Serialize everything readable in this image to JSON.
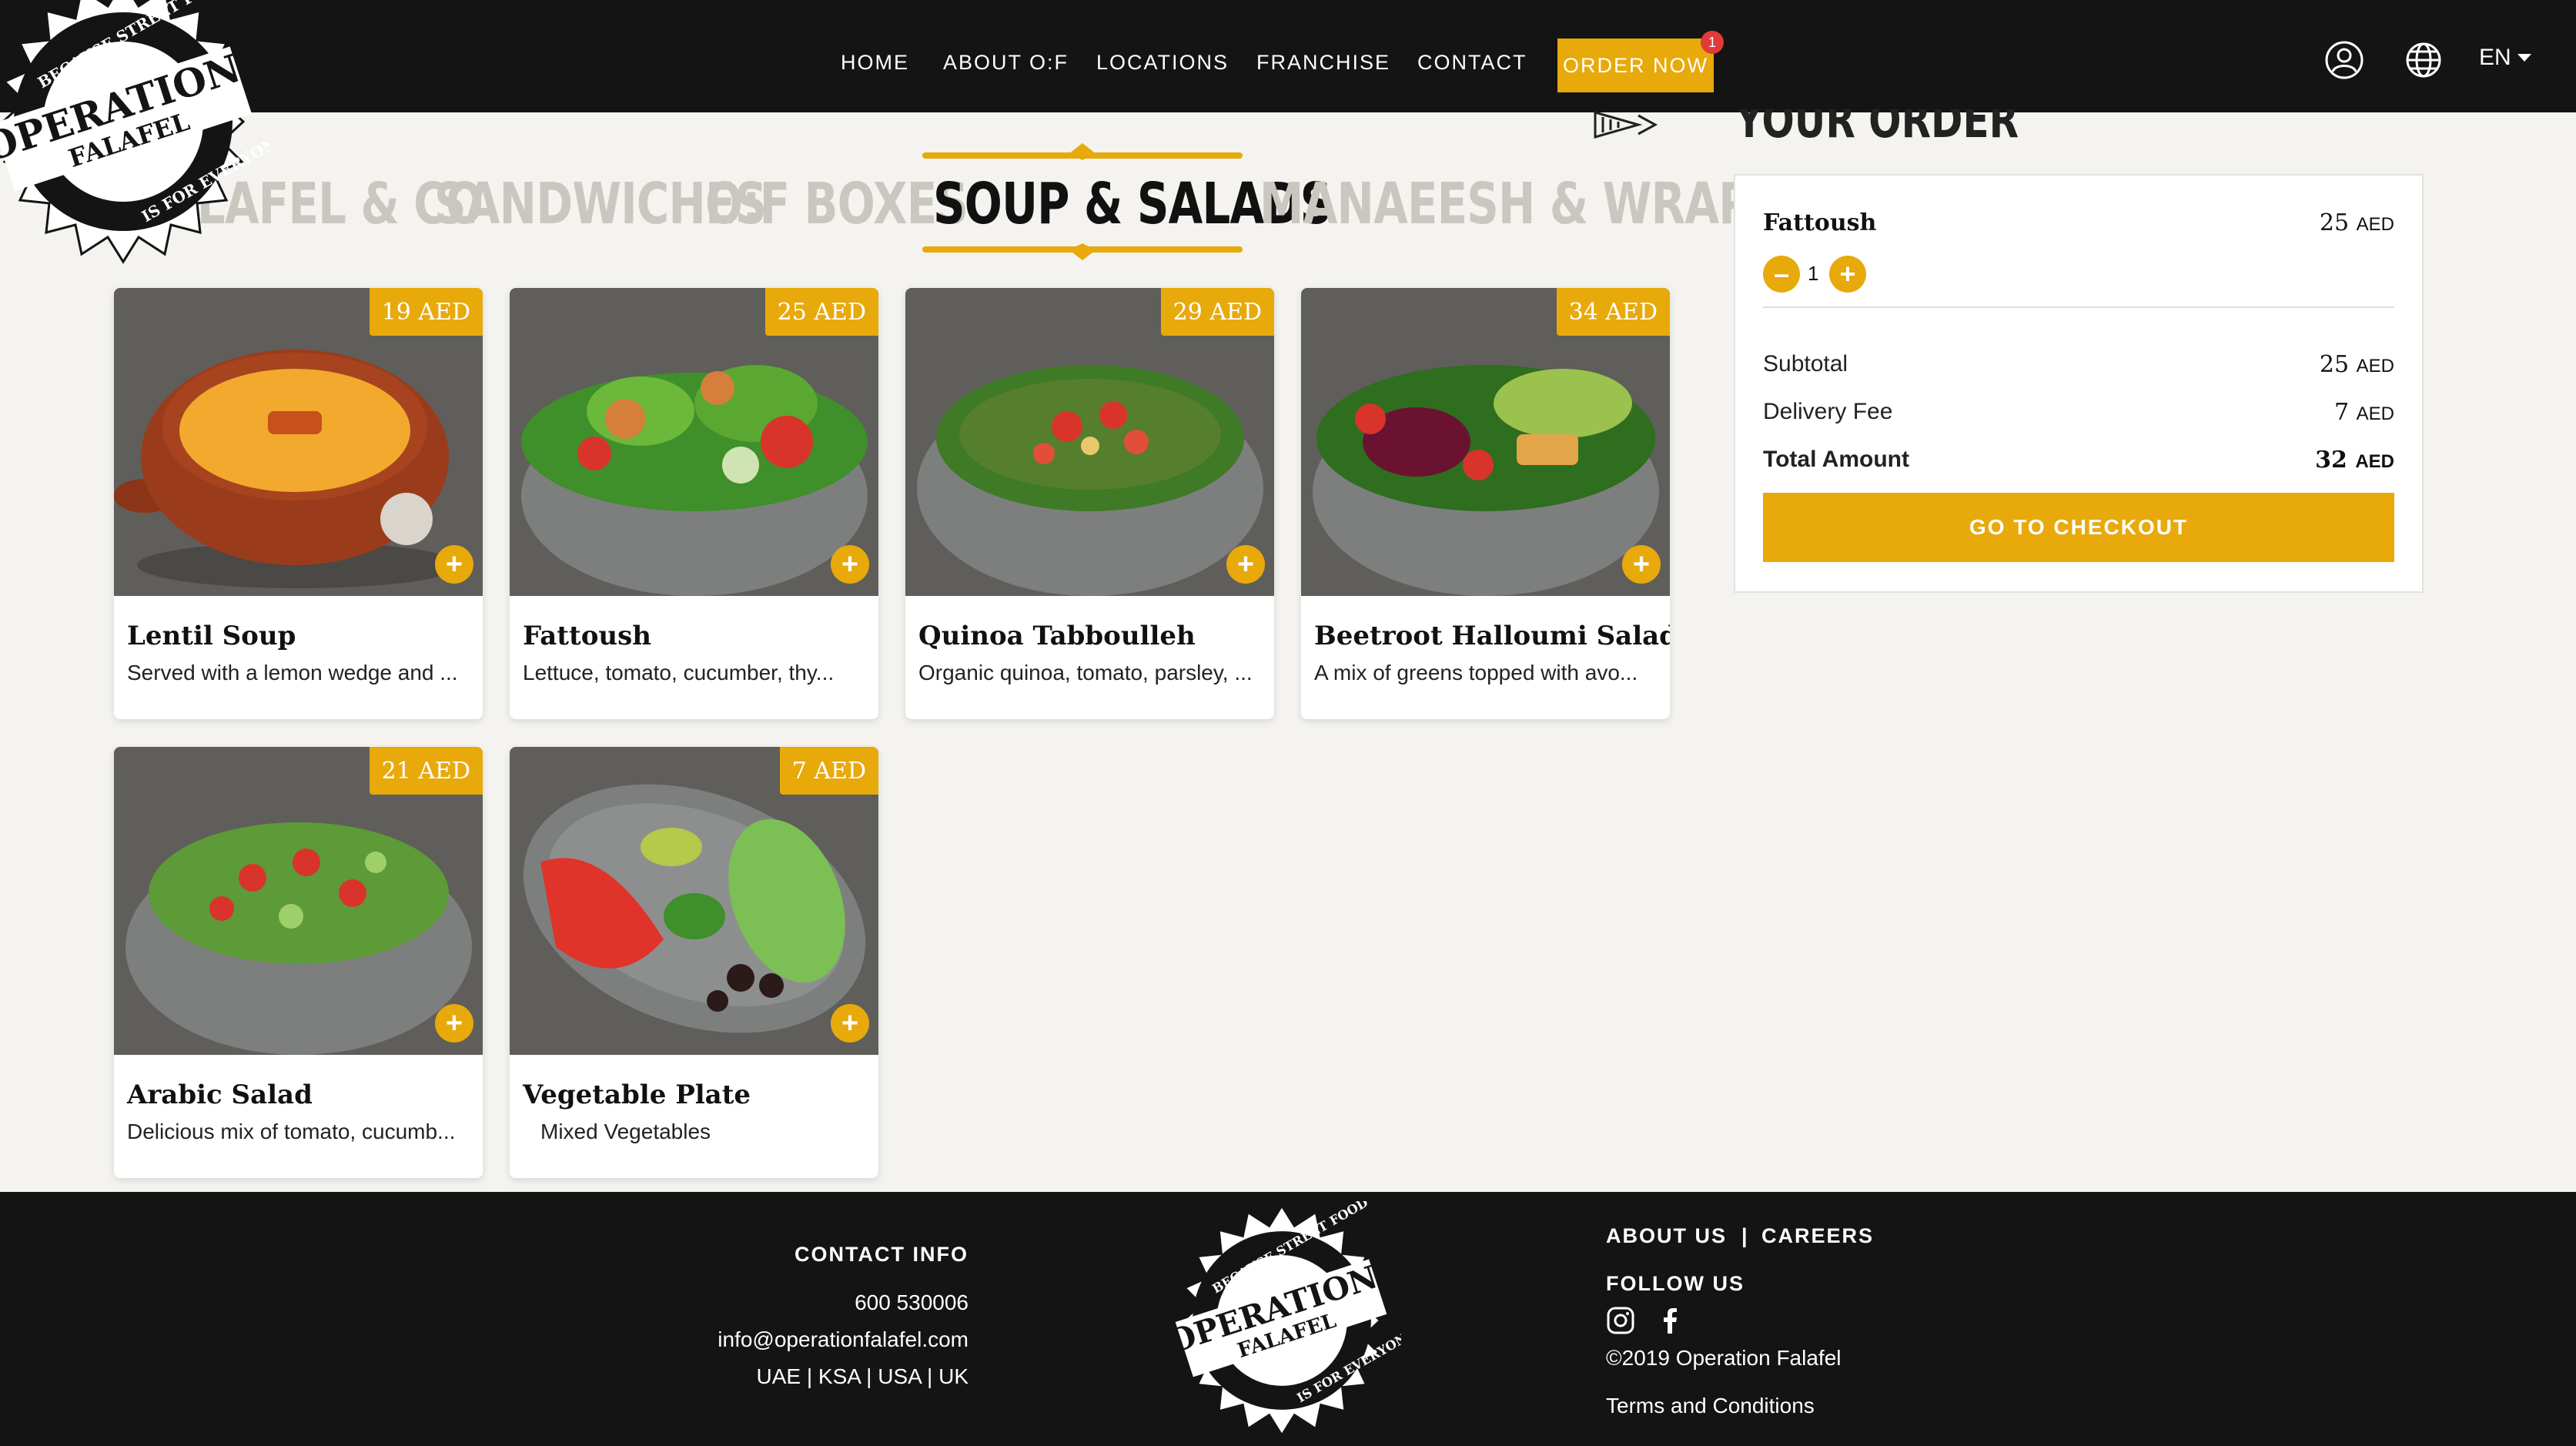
{
  "header": {
    "nav": [
      "HOME",
      "ABOUT O:F",
      "LOCATIONS",
      "FRANCHISE",
      "CONTACT"
    ],
    "order_now": "ORDER NOW",
    "cart_count": "1",
    "language": "EN"
  },
  "logo": {
    "top_text": "BECAUSE STREET FOOD",
    "line1": "OPERATION:",
    "line2": "FALAFEL",
    "bottom_text": "IS FOR EVERYONE"
  },
  "categories": [
    "FALAFEL & CO",
    "SANDWICHES",
    "O:F BOXES",
    "SOUP & SALADS",
    "MANAEESH & WRAPS"
  ],
  "active_category": "SOUP & SALADS",
  "products": [
    {
      "price": "19 AED",
      "name": "Lentil Soup",
      "desc": "Served with a lemon wedge and ..."
    },
    {
      "price": "25 AED",
      "name": "Fattoush",
      "desc": "Lettuce, tomato, cucumber, thy..."
    },
    {
      "price": "29 AED",
      "name": "Quinoa Tabboulleh",
      "desc": "Organic quinoa, tomato, parsley, ..."
    },
    {
      "price": "34 AED",
      "name": "Beetroot Halloumi Salad",
      "desc": "A mix of greens topped with avo..."
    },
    {
      "price": "21 AED",
      "name": "Arabic Salad",
      "desc": "Delicious mix of tomato, cucumb..."
    },
    {
      "price": "7 AED",
      "name": "Vegetable Plate",
      "desc": "Mixed Vegetables"
    }
  ],
  "order": {
    "title": "YOUR ORDER",
    "item_name": "Fattoush",
    "item_price": "25",
    "currency": "AED",
    "quantity": "1",
    "subtotal_label": "Subtotal",
    "subtotal": "25",
    "delivery_label": "Delivery Fee",
    "delivery": "7",
    "total_label": "Total Amount",
    "total": "32",
    "checkout": "GO TO CHECKOUT"
  },
  "footer": {
    "contact_heading": "CONTACT INFO",
    "phone": "600 530006",
    "email": "info@operationfalafel.com",
    "countries": "UAE | KSA | USA | UK",
    "about": "ABOUT US",
    "careers": "CAREERS",
    "follow": "FOLLOW US",
    "copyright": "©2019 Operation Falafel",
    "terms": "Terms and Conditions"
  },
  "colors": {
    "accent": "#e8a90a",
    "dark": "#141414",
    "background": "#f4f3ef",
    "badge": "#e03a3a"
  }
}
